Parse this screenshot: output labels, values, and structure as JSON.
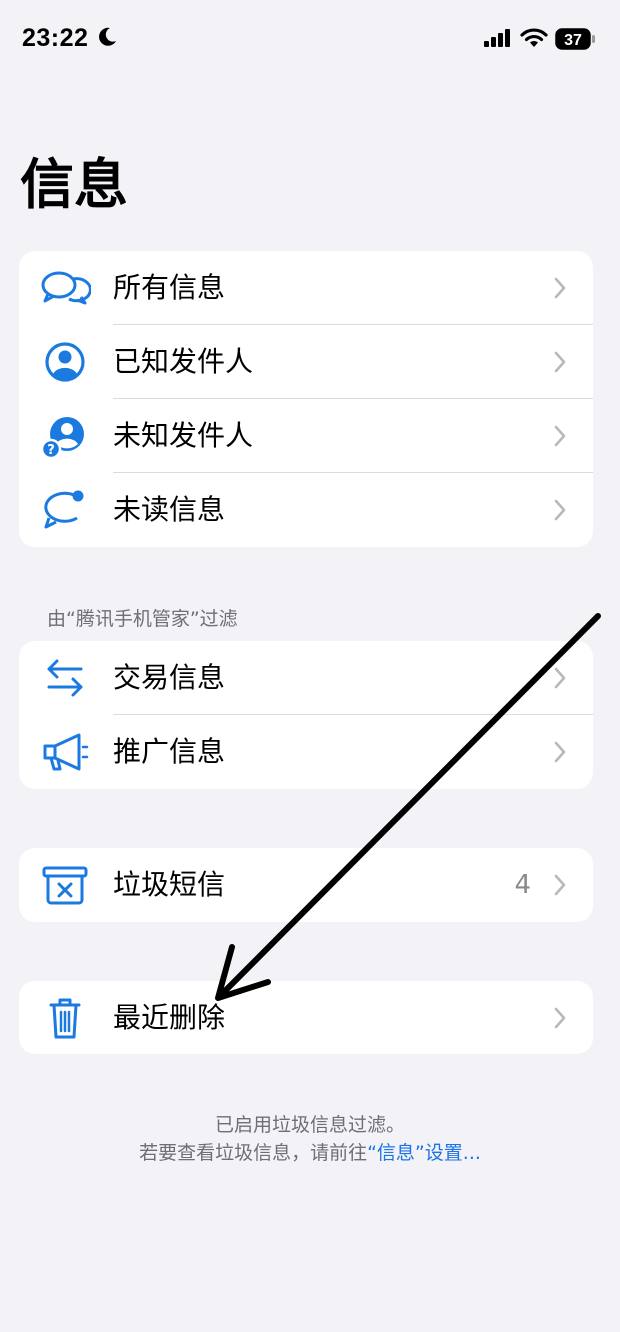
{
  "status_bar": {
    "time": "23:22",
    "battery_level": "37",
    "icons": [
      "moon-icon",
      "cellular-signal-icon",
      "wifi-icon",
      "battery-icon"
    ]
  },
  "page_title": "信息",
  "accent_color": "#1a7ae0",
  "filters_group": {
    "items": [
      {
        "label": "所有信息",
        "icon": "chat-bubbles-icon"
      },
      {
        "label": "已知发件人",
        "icon": "person-circle-icon"
      },
      {
        "label": "未知发件人",
        "icon": "unknown-person-icon"
      },
      {
        "label": "未读信息",
        "icon": "unread-bubble-icon"
      }
    ]
  },
  "filter_section": {
    "header": "由“腾讯手机管家”过滤",
    "items": [
      {
        "label": "交易信息",
        "icon": "transactions-arrows-icon"
      },
      {
        "label": "推广信息",
        "icon": "megaphone-icon"
      }
    ]
  },
  "junk": {
    "label": "垃圾短信",
    "count": "4",
    "icon": "junk-box-icon"
  },
  "recently_deleted": {
    "label": "最近删除",
    "icon": "trash-icon"
  },
  "footer": {
    "line1": "已启用垃圾信息过滤。",
    "line2_prefix": "若要查看垃圾信息，请前往",
    "line2_link": "“信息”设置..."
  }
}
